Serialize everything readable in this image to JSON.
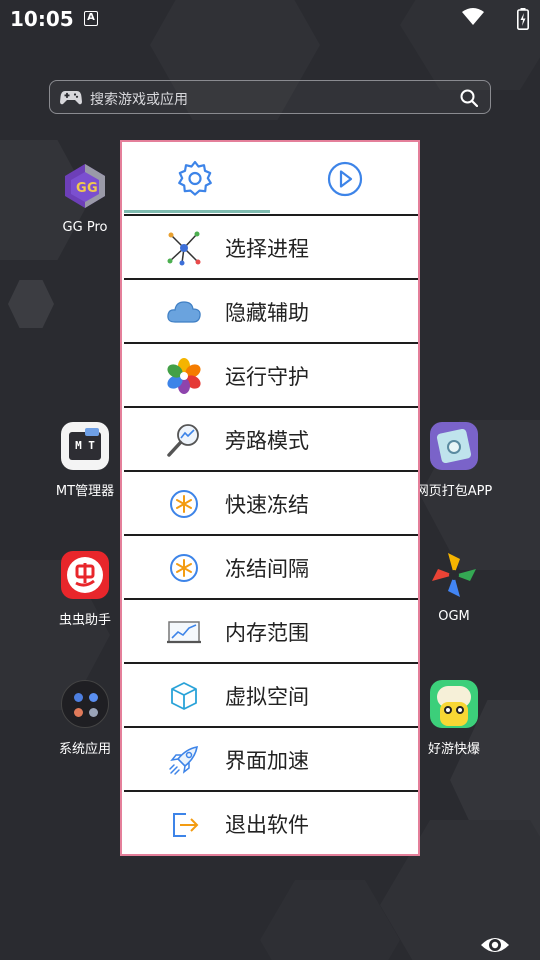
{
  "status_bar": {
    "time": "10:05",
    "notification_badge": "A"
  },
  "search": {
    "placeholder": "搜索游戏或应用"
  },
  "apps": {
    "gg_pro": "GG Pro",
    "mt": "MT管理器",
    "mt_icon_text": "M T",
    "chongchong": "虫虫助手",
    "system": "系统应用",
    "web_pack": "网页打包APP",
    "ogm": "OGM",
    "haoyou": "好游快爆"
  },
  "menu": {
    "tabs": [
      {
        "icon": "gear-icon"
      },
      {
        "icon": "play-circle-icon"
      }
    ],
    "items": [
      {
        "label": "选择进程",
        "icon": "process-network-icon"
      },
      {
        "label": "隐藏辅助",
        "icon": "cloud-icon"
      },
      {
        "label": "运行守护",
        "icon": "flower-icon"
      },
      {
        "label": "旁路模式",
        "icon": "magnifier-chart-icon"
      },
      {
        "label": "快速冻结",
        "icon": "snowflake-icon"
      },
      {
        "label": "冻结间隔",
        "icon": "snowflake-icon"
      },
      {
        "label": "内存范围",
        "icon": "memory-chart-icon"
      },
      {
        "label": "虚拟空间",
        "icon": "cube-icon"
      },
      {
        "label": "界面加速",
        "icon": "rocket-icon"
      },
      {
        "label": "退出软件",
        "icon": "exit-icon"
      }
    ]
  },
  "colors": {
    "accent_blue": "#3d84e8",
    "menu_border": "#e47f9a",
    "tab_indicator": "#7fbcb0"
  }
}
